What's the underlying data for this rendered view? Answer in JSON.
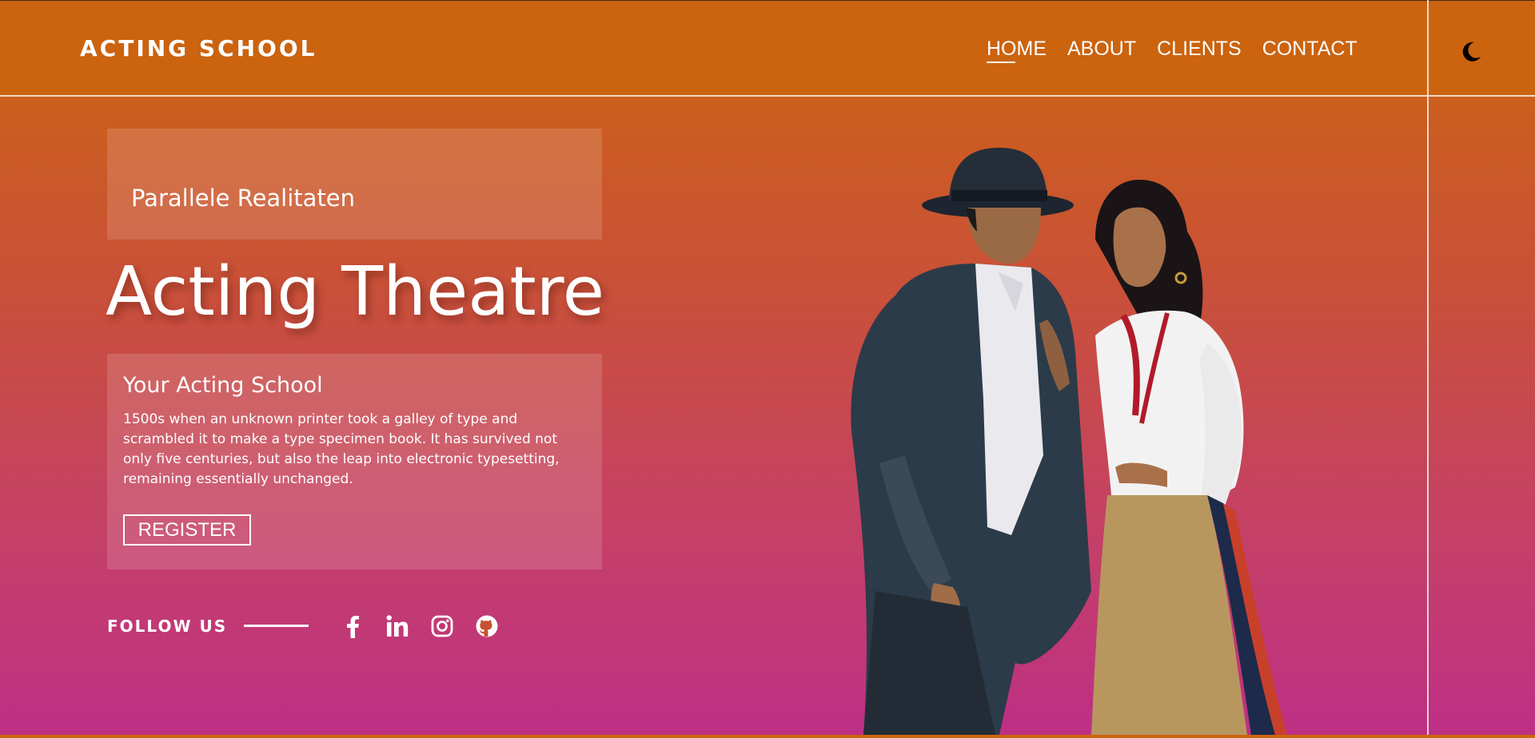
{
  "header": {
    "logo": "ACTING SCHOOL",
    "nav": [
      {
        "label": "HOME",
        "active": true
      },
      {
        "label": "ABOUT"
      },
      {
        "label": "CLIENTS"
      },
      {
        "label": "CONTACT"
      }
    ],
    "theme_icon": "moon-icon"
  },
  "hero": {
    "subtitle": "Parallele Realitaten",
    "title": "Acting Theatre",
    "card": {
      "heading": "Your Acting School",
      "body": "1500s when an unknown printer took a galley of type and scrambled it to make a type specimen book. It has survived not only five centuries, but also the leap into electronic typesetting, remaining essentially unchanged.",
      "button": "REGISTER"
    }
  },
  "follow": {
    "label": "FOLLOW US",
    "icons": [
      "facebook-icon",
      "linkedin-icon",
      "instagram-icon",
      "github-icon"
    ]
  },
  "colors": {
    "header_bg": "#cb630f",
    "gradient_top": "#cd650f",
    "gradient_bottom": "#be2f85"
  }
}
